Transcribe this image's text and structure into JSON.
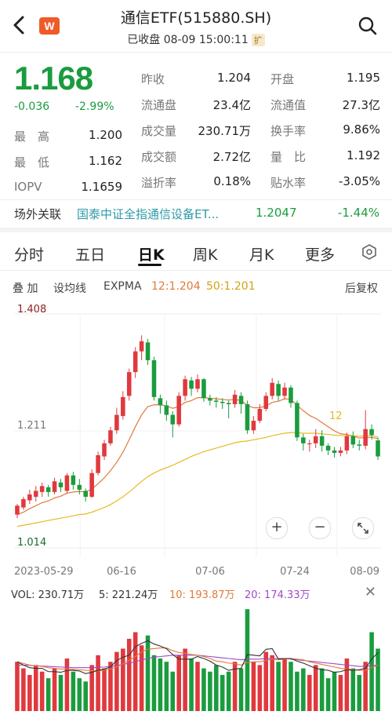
{
  "header": {
    "back_icon": "back-arrow-icon",
    "logo_text": "W",
    "title": "通信ETF(515880.SH)",
    "status": "已收盘 08-09 15:00:11",
    "expand_badge": "扩",
    "search_icon": "search-icon"
  },
  "quote": {
    "price": "1.168",
    "change": "-0.036",
    "change_pct": "-2.99%",
    "rows": [
      [
        {
          "label": "昨收",
          "value": "1.204",
          "color": "#222"
        },
        {
          "label": "开盘",
          "value": "1.195",
          "color": "#222"
        }
      ],
      [
        {
          "label": "流通盘",
          "value": "23.4亿",
          "color": "#222"
        },
        {
          "label": "流通值",
          "value": "27.3亿",
          "color": "#222"
        }
      ],
      [
        {
          "label": "成交量",
          "value": "230.71万",
          "color": "#222"
        },
        {
          "label": "换手率",
          "value": "9.86%",
          "color": "#222"
        }
      ],
      [
        {
          "label": "成交额",
          "value": "2.72亿",
          "color": "#222"
        },
        {
          "label": "量　比",
          "value": "1.192",
          "color": "#222"
        }
      ],
      [
        {
          "label": "溢折率",
          "value": "0.18%",
          "color": "#222"
        },
        {
          "label": "贴水率",
          "value": "-3.05%",
          "color": "#222"
        }
      ]
    ],
    "left_rows": [
      {
        "label": "最　高",
        "value": "1.200"
      },
      {
        "label": "最　低",
        "value": "1.162"
      },
      {
        "label": "IOPV",
        "value": "1.1659"
      }
    ]
  },
  "related": {
    "label": "场外关联",
    "name": "国泰中证全指通信设备ET...",
    "value": "1.2047",
    "pct": "-1.44%"
  },
  "tabs": [
    "分时",
    "五日",
    "日K",
    "周K",
    "月K",
    "更多"
  ],
  "active_tab": "日K",
  "toolbar": {
    "overlay": "叠 加",
    "ma_setting": "设均线",
    "expma": "EXPMA",
    "ema12": "12:1.204",
    "ema50": "50:1.201",
    "adjust": "后复权"
  },
  "chart_data": {
    "type": "candlestick",
    "y_labels": {
      "top": "1.408",
      "mid": "1.211",
      "bottom": "1.014"
    },
    "ylim": [
      1.014,
      1.408
    ],
    "x_labels": [
      "2023-05-29",
      "06-16",
      "07-06",
      "07-24",
      "08-09"
    ],
    "ema_label": "12",
    "colors": {
      "up": "#e0393e",
      "down": "#1a9c3e",
      "ema12": "#e07a3a",
      "ema50": "#e8b923"
    },
    "candles": [
      [
        1.07,
        1.085,
        1.064,
        1.088
      ],
      [
        1.082,
        1.096,
        1.078,
        1.1
      ],
      [
        1.094,
        1.104,
        1.088,
        1.112
      ],
      [
        1.1,
        1.11,
        1.092,
        1.118
      ],
      [
        1.108,
        1.118,
        1.1,
        1.124
      ],
      [
        1.116,
        1.108,
        1.1,
        1.12
      ],
      [
        1.108,
        1.126,
        1.104,
        1.132
      ],
      [
        1.124,
        1.116,
        1.108,
        1.13
      ],
      [
        1.11,
        1.136,
        1.106,
        1.14
      ],
      [
        1.136,
        1.12,
        1.112,
        1.142
      ],
      [
        1.12,
        1.112,
        1.104,
        1.13
      ],
      [
        1.11,
        1.1,
        1.092,
        1.114
      ],
      [
        1.1,
        1.14,
        1.098,
        1.146
      ],
      [
        1.14,
        1.17,
        1.136,
        1.176
      ],
      [
        1.168,
        1.19,
        1.162,
        1.196
      ],
      [
        1.19,
        1.212,
        1.186,
        1.218
      ],
      [
        1.212,
        1.238,
        1.206,
        1.25
      ],
      [
        1.236,
        1.268,
        1.23,
        1.278
      ],
      [
        1.27,
        1.31,
        1.262,
        1.316
      ],
      [
        1.31,
        1.345,
        1.3,
        1.352
      ],
      [
        1.345,
        1.362,
        1.33,
        1.372
      ],
      [
        1.36,
        1.33,
        1.322,
        1.366
      ],
      [
        1.33,
        1.268,
        1.262,
        1.336
      ],
      [
        1.266,
        1.254,
        1.24,
        1.272
      ],
      [
        1.254,
        1.238,
        1.228,
        1.262
      ],
      [
        1.238,
        1.222,
        1.2,
        1.244
      ],
      [
        1.222,
        1.27,
        1.218,
        1.276
      ],
      [
        1.27,
        1.298,
        1.262,
        1.304
      ],
      [
        1.296,
        1.282,
        1.27,
        1.302
      ],
      [
        1.282,
        1.298,
        1.276,
        1.306
      ],
      [
        1.298,
        1.266,
        1.26,
        1.3
      ],
      [
        1.266,
        1.262,
        1.254,
        1.272
      ],
      [
        1.262,
        1.26,
        1.25,
        1.268
      ],
      [
        1.26,
        1.258,
        1.248,
        1.266
      ],
      [
        1.258,
        1.256,
        1.232,
        1.262
      ],
      [
        1.256,
        1.272,
        1.25,
        1.28
      ],
      [
        1.27,
        1.256,
        1.24,
        1.276
      ],
      [
        1.256,
        1.212,
        1.206,
        1.262
      ],
      [
        1.212,
        1.228,
        1.206,
        1.236
      ],
      [
        1.228,
        1.248,
        1.224,
        1.256
      ],
      [
        1.248,
        1.27,
        1.244,
        1.276
      ],
      [
        1.27,
        1.292,
        1.264,
        1.3
      ],
      [
        1.29,
        1.27,
        1.262,
        1.296
      ],
      [
        1.27,
        1.284,
        1.264,
        1.292
      ],
      [
        1.284,
        1.258,
        1.25,
        1.288
      ],
      [
        1.258,
        1.2,
        1.194,
        1.262
      ],
      [
        1.2,
        1.19,
        1.178,
        1.206
      ],
      [
        1.19,
        1.19,
        1.176,
        1.196
      ],
      [
        1.19,
        1.202,
        1.182,
        1.214
      ],
      [
        1.202,
        1.186,
        1.176,
        1.212
      ],
      [
        1.186,
        1.178,
        1.17,
        1.19
      ],
      [
        1.178,
        1.174,
        1.166,
        1.184
      ],
      [
        1.174,
        1.178,
        1.168,
        1.184
      ],
      [
        1.178,
        1.202,
        1.172,
        1.208
      ],
      [
        1.202,
        1.188,
        1.182,
        1.21
      ],
      [
        1.188,
        1.186,
        1.178,
        1.196
      ],
      [
        1.186,
        1.214,
        1.18,
        1.246
      ],
      [
        1.214,
        1.204,
        1.196,
        1.222
      ],
      [
        1.195,
        1.168,
        1.162,
        1.2
      ]
    ],
    "ema12": [
      1.07,
      1.074,
      1.08,
      1.085,
      1.09,
      1.093,
      1.098,
      1.101,
      1.106,
      1.108,
      1.109,
      1.108,
      1.113,
      1.122,
      1.132,
      1.144,
      1.158,
      1.175,
      1.196,
      1.218,
      1.238,
      1.252,
      1.255,
      1.255,
      1.253,
      1.249,
      1.252,
      1.259,
      1.262,
      1.267,
      1.267,
      1.266,
      1.265,
      1.264,
      1.263,
      1.264,
      1.262,
      1.254,
      1.25,
      1.25,
      1.253,
      1.259,
      1.261,
      1.265,
      1.264,
      1.254,
      1.245,
      1.237,
      1.232,
      1.225,
      1.218,
      1.211,
      1.206,
      1.205,
      1.202,
      1.199,
      1.2,
      1.2,
      1.198
    ],
    "ema50": [
      1.05,
      1.052,
      1.054,
      1.056,
      1.058,
      1.06,
      1.062,
      1.064,
      1.066,
      1.068,
      1.07,
      1.071,
      1.074,
      1.078,
      1.082,
      1.087,
      1.093,
      1.1,
      1.108,
      1.117,
      1.126,
      1.134,
      1.14,
      1.145,
      1.149,
      1.153,
      1.158,
      1.163,
      1.168,
      1.172,
      1.176,
      1.179,
      1.182,
      1.185,
      1.188,
      1.191,
      1.193,
      1.194,
      1.196,
      1.198,
      1.2,
      1.203,
      1.205,
      1.207,
      1.208,
      1.208,
      1.207,
      1.207,
      1.207,
      1.206,
      1.205,
      1.204,
      1.203,
      1.203,
      1.203,
      1.202,
      1.203,
      1.203,
      1.201
    ]
  },
  "volume": {
    "vol_label": "VOL: 230.71万",
    "ma5": "5: 221.24万",
    "ma10": "10: 193.87万",
    "ma20": "20: 174.33万",
    "close_icon": "close-icon",
    "values": [
      150,
      130,
      110,
      140,
      120,
      100,
      130,
      110,
      160,
      120,
      100,
      90,
      140,
      170,
      130,
      150,
      180,
      190,
      220,
      240,
      200,
      230,
      170,
      160,
      150,
      120,
      170,
      190,
      160,
      150,
      130,
      120,
      140,
      110,
      120,
      150,
      130,
      310,
      150,
      140,
      180,
      170,
      150,
      160,
      150,
      120,
      130,
      110,
      140,
      130,
      100,
      120,
      110,
      160,
      130,
      110,
      150,
      240,
      190
    ],
    "ma5_line": [
      150,
      140,
      132,
      130,
      130,
      120,
      120,
      118,
      124,
      124,
      122,
      114,
      118,
      124,
      128,
      134,
      154,
      164,
      170,
      196,
      206,
      214,
      204,
      198,
      190,
      172,
      158,
      158,
      158,
      166,
      160,
      152,
      140,
      134,
      124,
      128,
      130,
      172,
      170,
      168,
      188,
      190,
      158,
      160,
      160,
      152,
      146,
      138,
      130,
      126,
      124,
      118,
      120,
      126,
      124,
      126,
      130,
      158,
      178
    ],
    "ma10_line": [
      150,
      145,
      140,
      138,
      136,
      132,
      130,
      128,
      128,
      127,
      126,
      124,
      123,
      122,
      124,
      128,
      134,
      144,
      154,
      166,
      180,
      188,
      190,
      192,
      192,
      184,
      178,
      176,
      172,
      170,
      166,
      160,
      152,
      150,
      146,
      144,
      140,
      148,
      150,
      150,
      154,
      158,
      156,
      158,
      160,
      158,
      156,
      150,
      146,
      142,
      138,
      134,
      130,
      128,
      126,
      124,
      124,
      132,
      140
    ],
    "ma20_line": [
      140,
      140,
      139,
      138,
      137,
      136,
      135,
      134,
      133,
      132,
      132,
      132,
      132,
      133,
      134,
      136,
      138,
      142,
      146,
      150,
      156,
      160,
      164,
      166,
      168,
      170,
      170,
      170,
      170,
      170,
      168,
      166,
      164,
      162,
      160,
      158,
      156,
      158,
      158,
      158,
      160,
      160,
      160,
      160,
      158,
      156,
      154,
      152,
      150,
      148,
      146,
      144,
      142,
      140,
      138,
      136,
      136,
      138,
      140
    ]
  }
}
